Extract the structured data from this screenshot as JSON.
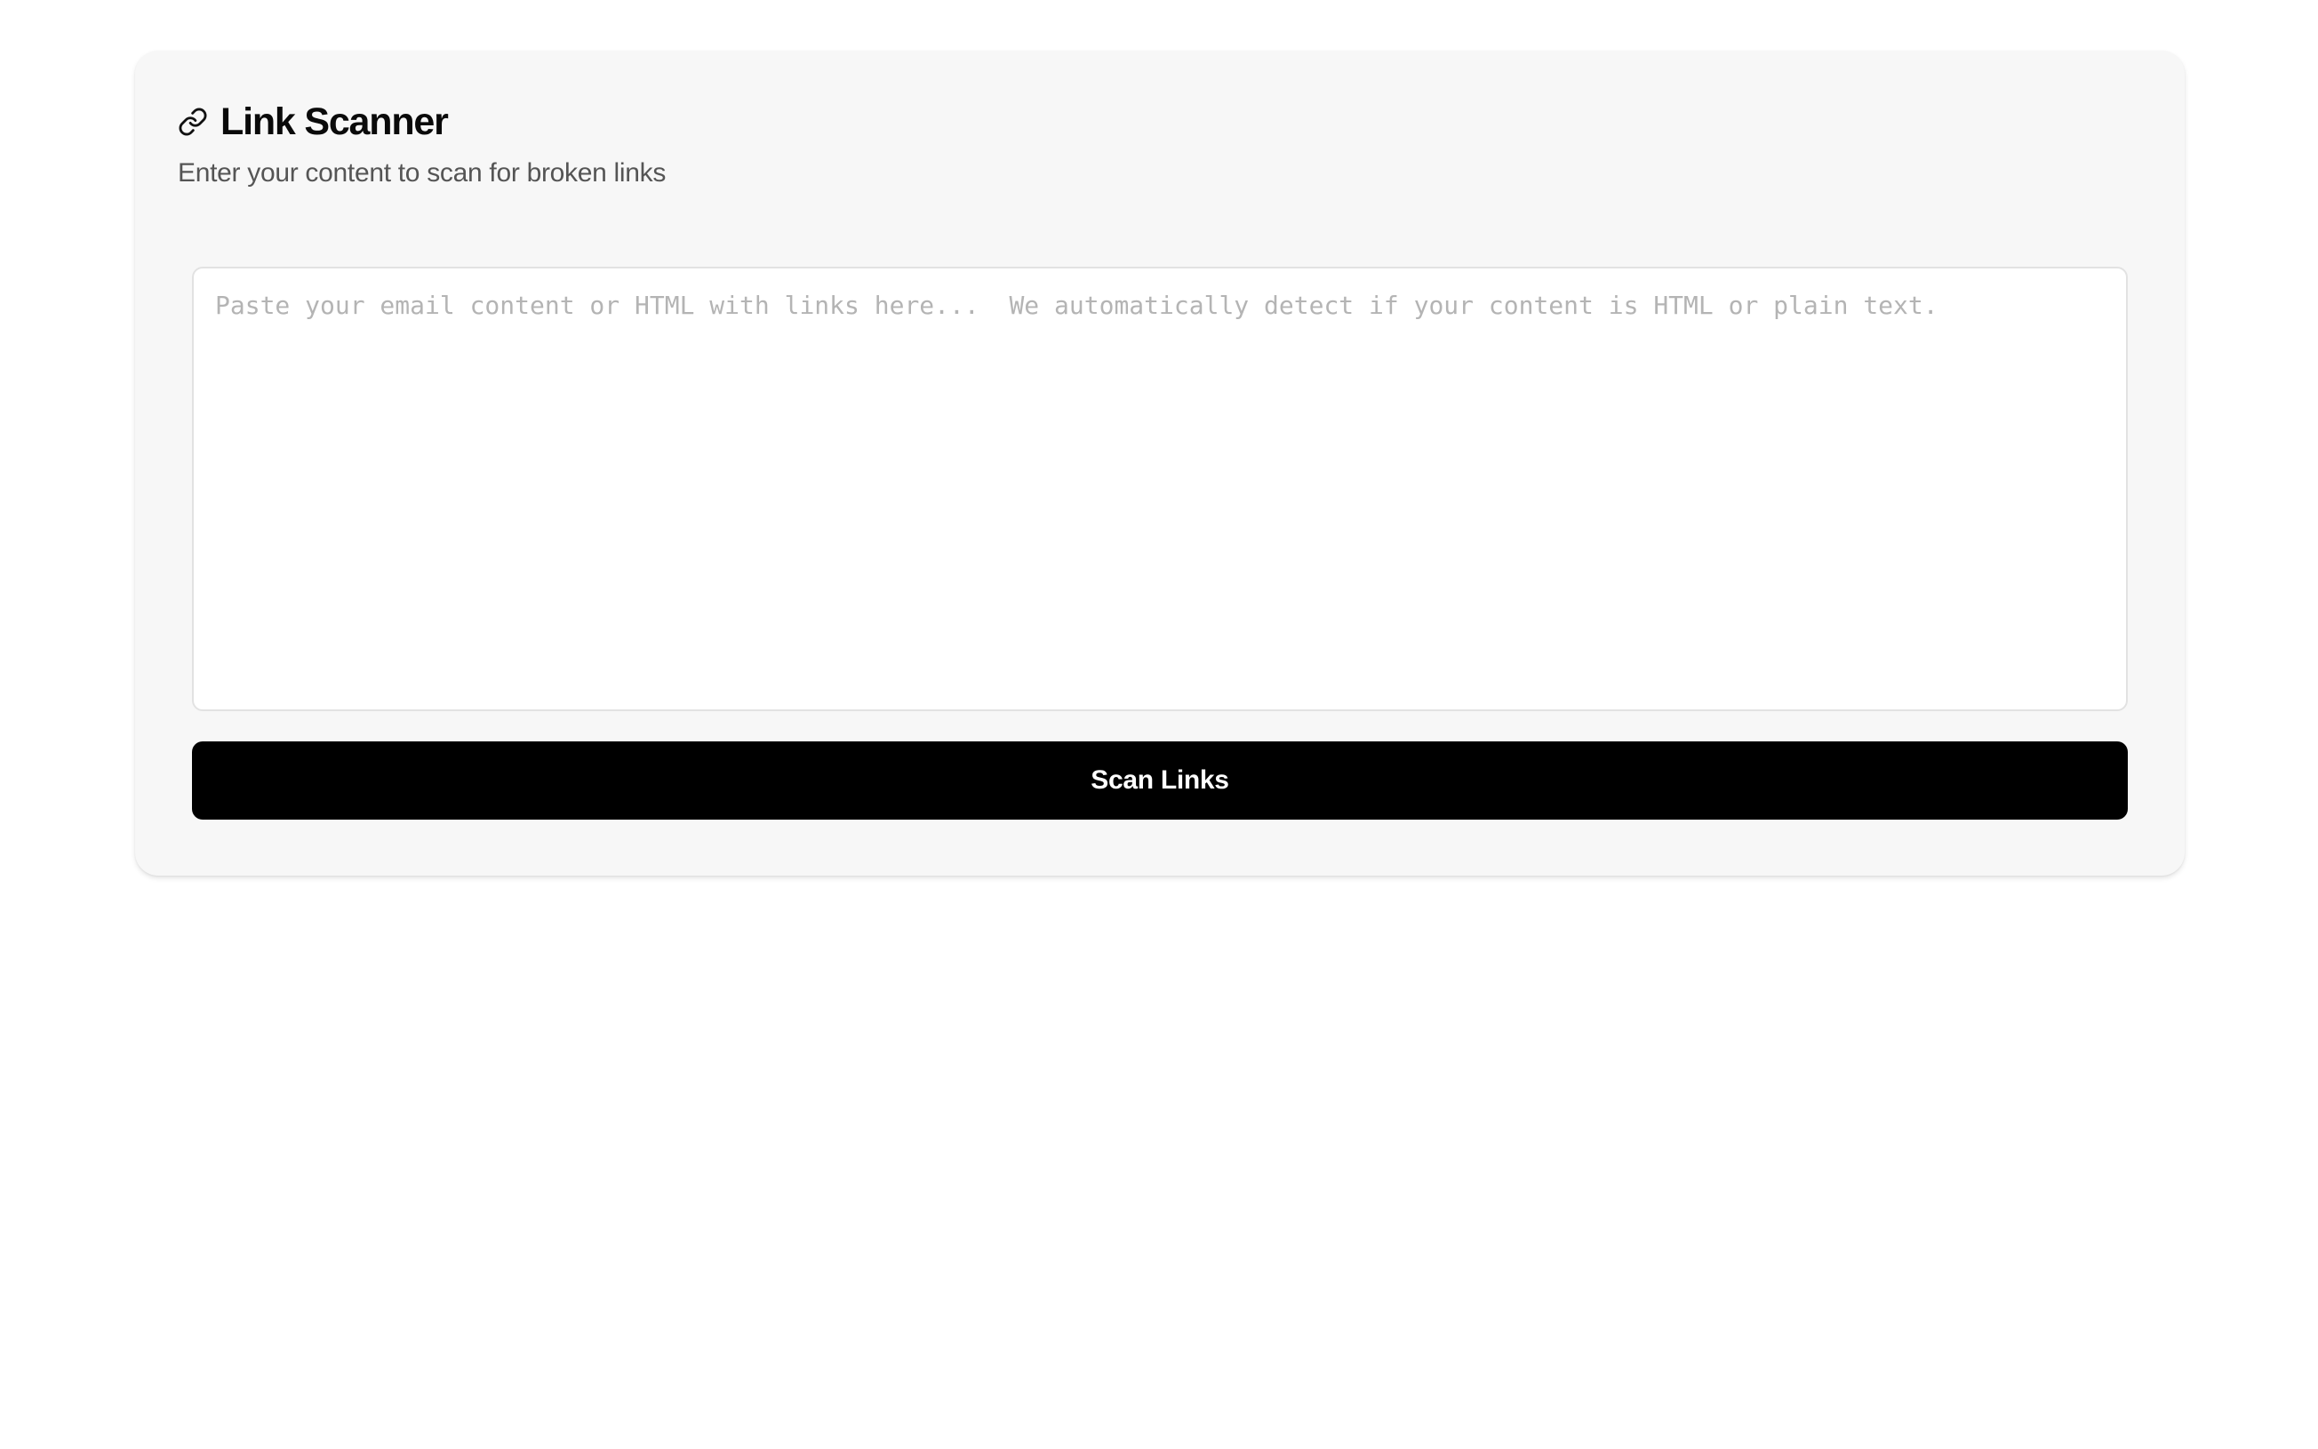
{
  "app": {
    "title": "Link Scanner",
    "subtitle": "Enter your content to scan for broken links",
    "icon": "link-icon"
  },
  "input": {
    "value": "",
    "placeholder": "Paste your email content or HTML with links here...  We automatically detect if your content is HTML or plain text."
  },
  "actions": {
    "scan_label": "Scan Links"
  },
  "colors": {
    "page_background": "#ffffff",
    "card_background": "#f7f7f7",
    "button_background": "#000000",
    "button_text": "#ffffff",
    "title_text": "#0a0a0a",
    "subtitle_text": "#555555",
    "placeholder_text": "#b4b4b4"
  }
}
